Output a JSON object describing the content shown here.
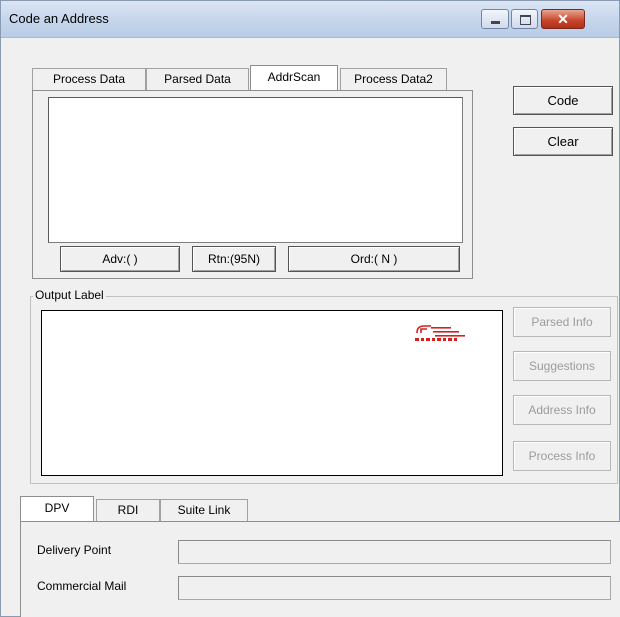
{
  "window": {
    "title": "Code an Address",
    "close_glyph": "✕"
  },
  "top_tabs": [
    {
      "label": "Process Data"
    },
    {
      "label": "Parsed Data"
    },
    {
      "label": "AddrScan"
    },
    {
      "label": "Process Data2"
    }
  ],
  "top_tabs_active_index": 2,
  "addrscan_buttons": {
    "adv": "Adv:( )",
    "rtn": "Rtn:(95N)",
    "ord": "Ord:( N )"
  },
  "side_buttons": {
    "code": "Code",
    "clear": "Clear"
  },
  "output_group": {
    "label": "Output Label",
    "logo_icon": "barcode-logo-icon",
    "logo_color": "#d42020"
  },
  "info_buttons": [
    {
      "label": "Parsed Info",
      "enabled": false
    },
    {
      "label": "Suggestions",
      "enabled": false
    },
    {
      "label": "Address Info",
      "enabled": false
    },
    {
      "label": "Process Info",
      "enabled": false
    }
  ],
  "bottom_tabs": [
    {
      "label": "DPV"
    },
    {
      "label": "RDI"
    },
    {
      "label": "Suite Link"
    }
  ],
  "bottom_tabs_active_index": 0,
  "dpv_fields": {
    "delivery_point_label": "Delivery Point",
    "delivery_point_value": "",
    "commercial_mail_label": "Commercial Mail",
    "commercial_mail_value": ""
  }
}
